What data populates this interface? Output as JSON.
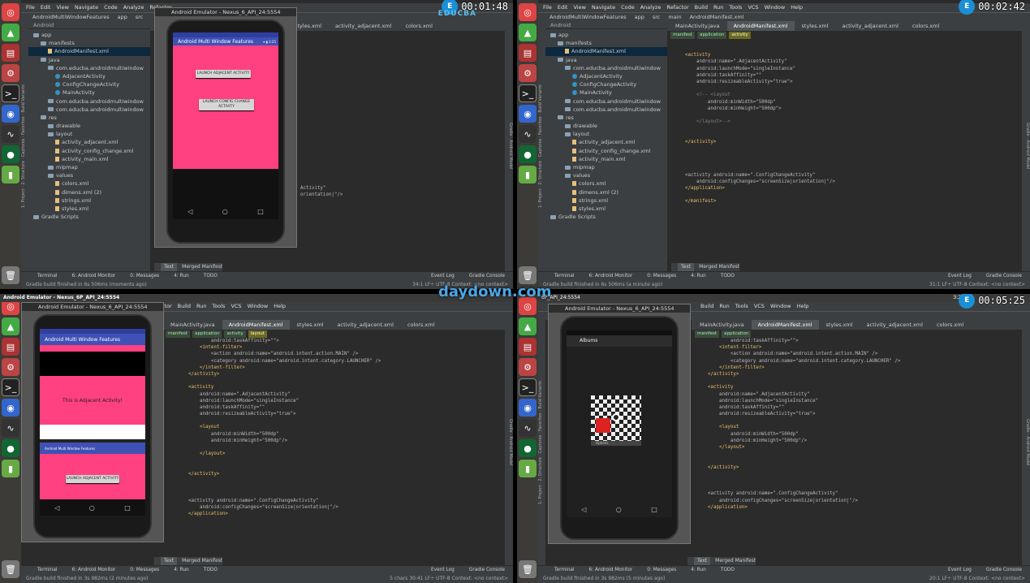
{
  "menu": [
    "File",
    "Edit",
    "View",
    "Navigate",
    "Code",
    "Analyze",
    "Refactor",
    "Build",
    "Run",
    "Tools",
    "VCS",
    "Window",
    "Help"
  ],
  "brand": "EDUCBA",
  "watermark": "daydown.com",
  "q1": {
    "time": "00:01:48",
    "crumbs": [
      "AndroidMultiWindowFeatures",
      "app",
      "src"
    ],
    "project_header": "Android",
    "tree": [
      {
        "label": "app",
        "kind": "folder",
        "depth": 0
      },
      {
        "label": "manifests",
        "kind": "folder",
        "depth": 1
      },
      {
        "label": "AndroidManifest.xml",
        "kind": "file",
        "depth": 2,
        "selected": true
      },
      {
        "label": "java",
        "kind": "folder",
        "depth": 1
      },
      {
        "label": "com.educba.androidmultiwindow",
        "kind": "folder",
        "depth": 2
      },
      {
        "label": "AdjacentActivity",
        "kind": "class",
        "depth": 3
      },
      {
        "label": "ConfigChangeActivity",
        "kind": "class",
        "depth": 3
      },
      {
        "label": "MainActivity",
        "kind": "class",
        "depth": 3
      },
      {
        "label": "com.educba.androidmultiwindow",
        "kind": "folder",
        "depth": 2
      },
      {
        "label": "com.educba.androidmultiwindow",
        "kind": "folder",
        "depth": 2
      },
      {
        "label": "res",
        "kind": "folder",
        "depth": 1
      },
      {
        "label": "drawable",
        "kind": "folder",
        "depth": 2
      },
      {
        "label": "layout",
        "kind": "folder",
        "depth": 2
      },
      {
        "label": "activity_adjacent.xml",
        "kind": "file",
        "depth": 3
      },
      {
        "label": "activity_config_change.xml",
        "kind": "file",
        "depth": 3
      },
      {
        "label": "activity_main.xml",
        "kind": "file",
        "depth": 3
      },
      {
        "label": "mipmap",
        "kind": "folder",
        "depth": 2
      },
      {
        "label": "values",
        "kind": "folder",
        "depth": 2
      },
      {
        "label": "colors.xml",
        "kind": "file",
        "depth": 3
      },
      {
        "label": "dimens.xml (2)",
        "kind": "file",
        "depth": 3
      },
      {
        "label": "strings.xml",
        "kind": "file",
        "depth": 3
      },
      {
        "label": "styles.xml",
        "kind": "file",
        "depth": 3
      },
      {
        "label": "Gradle Scripts",
        "kind": "folder",
        "depth": 0
      }
    ],
    "tabs": [
      "styles.xml",
      "activity_adjacent.xml",
      "colors.xml"
    ],
    "code_tail": [
      "Activity\"",
      "orientation|\"/>"
    ],
    "emulator_title": "Android Emulator - Nexus_6_API_24:5554",
    "app_title": "Android Multi Window Features",
    "status_icons": "▾ ▮ 3:25",
    "btn1": "LAUNCH ADJACENT ACTIVITY",
    "btn2": "LAUNCH CONFIG CHANGE ACTIVITY",
    "bottom_tabs": [
      "Text",
      "Merged Manifest"
    ],
    "tools": [
      "Terminal",
      "6: Android Monitor",
      "0: Messages",
      "4: Run",
      "TODO",
      "Event Log",
      "Gradle Console"
    ],
    "status_left": "Gradle build finished in 6s 506ms (moments ago)",
    "status_right": "34:1  LF÷  UTF-8  Context: <no context>"
  },
  "q2": {
    "time": "00:02:42",
    "crumbs": [
      "AndroidMultiWindowFeatures",
      "app",
      "src",
      "main",
      "AndroidManifest.xml"
    ],
    "tabs": [
      "MainActivity.java",
      "AndroidManifest.xml",
      "styles.xml",
      "activity_adjacent.xml",
      "colors.xml"
    ],
    "breadcrumb": [
      "manifest",
      "application",
      "activity"
    ],
    "code": [
      "",
      "<activity",
      "    android:name=\".AdjacentActivity\"",
      "    android:launchMode=\"singleInstance\"",
      "    android:taskAffinity=\"\"",
      "    android:resizeableActivity=\"true\">",
      "",
      "    <!-- <layout",
      "        android:minWidth=\"500dp\"",
      "        android:minHeight=\"500dp\">",
      "",
      "    </layout>-->",
      "",
      "",
      "</activity>",
      "",
      "",
      "",
      "",
      "<activity android:name=\".ConfigChangeActivity\"",
      "    android:configChanges=\"screenSize|orientation|\"/>",
      "</application>",
      "",
      "</manifest>"
    ],
    "status_left": "Gradle build finished in 6s 506ms (a minute ago)",
    "status_right": "31:1  LF÷  UTF-8  Context: <no context>"
  },
  "q3": {
    "window_title": "Android Emulator - Nexus_6P_API_24:5554",
    "emulator_title": "Android Emulator - Nexus_6_API_24:5554",
    "tabs": [
      "MainActivity.java",
      "AndroidManifest.xml",
      "styles.xml",
      "activity_adjacent.xml",
      "colors.xml"
    ],
    "breadcrumb": [
      "manifest",
      "application",
      "activity",
      "layout"
    ],
    "app_title": "Android Multi Window Features",
    "adjacent_text": "This is Adjacent Activity!",
    "small_app_title": "Android Multi Window Features",
    "btn": "LAUNCH ADJACENT ACTIVITY",
    "code": [
      "        android:taskAffinity=\"\">",
      "    <intent-filter>",
      "        <action android:name=\"android.intent.action.MAIN\" />",
      "        <category android:name=\"android.intent.category.LAUNCHER\" />",
      "    </intent-filter>",
      "</activity>",
      "",
      "<activity",
      "    android:name=\".AdjacentActivity\"",
      "    android:launchMode=\"singleInstance\"",
      "    android:taskAffinity=\"\"",
      "    android:resizeableActivity=\"true\">",
      "",
      "    <layout",
      "        android:minWidth=\"500dp\"",
      "        android:minHeight=\"500dp\"/>",
      "",
      "    </layout>",
      "",
      "",
      "</activity>",
      "",
      "",
      "",
      "<activity android:name=\".ConfigChangeActivity\"",
      "    android:configChanges=\"screenSize|orientation|\"/>",
      "</application>"
    ],
    "status_left": "Gradle build finished in 3s 982ms (2 minutes ago)",
    "status_right": "5 chars  30:41  LF÷  UTF-8  Context: <no context>"
  },
  "q4": {
    "time": "00:05:25",
    "window_title": "6P_API_24:5554",
    "clock": "3:29 AM",
    "emulator_title": "Android Emulator - Nexus_6_API_24:5554",
    "albums": "Albums",
    "options": "Options",
    "tabs": [
      "MainActivity.java",
      "AndroidManifest.xml",
      "styles.xml",
      "activity_adjacent.xml",
      "colors.xml"
    ],
    "breadcrumb": [
      "manifest",
      "application"
    ],
    "code": [
      "        android:taskAffinity=\"\">",
      "    <intent-filter>",
      "        <action android:name=\"android.intent.action.MAIN\" />",
      "        <category android:name=\"android.intent.category.LAUNCHER\" />",
      "    </intent-filter>",
      "</activity>",
      "",
      "<activity",
      "    android:name=\".AdjacentActivity\"",
      "    android:launchMode=\"singleInstance\"",
      "    android:taskAffinity=\"\"",
      "    android:resizeableActivity=\"true\">",
      "",
      "    <layout",
      "        android:minWidth=\"500dp\"",
      "        android:minHeight=\"500dp\"/>",
      "    </layout>",
      "",
      "",
      "</activity>",
      "",
      "",
      "",
      "<activity android:name=\".ConfigChangeActivity\"",
      "    android:configChanges=\"screenSize|orientation|\"/>",
      "</application>"
    ],
    "status_left": "Gradle build finished in 3s 982ms (5 minutes ago)",
    "status_right": "20:1  LF÷  UTF-8  Context: <no context>"
  }
}
